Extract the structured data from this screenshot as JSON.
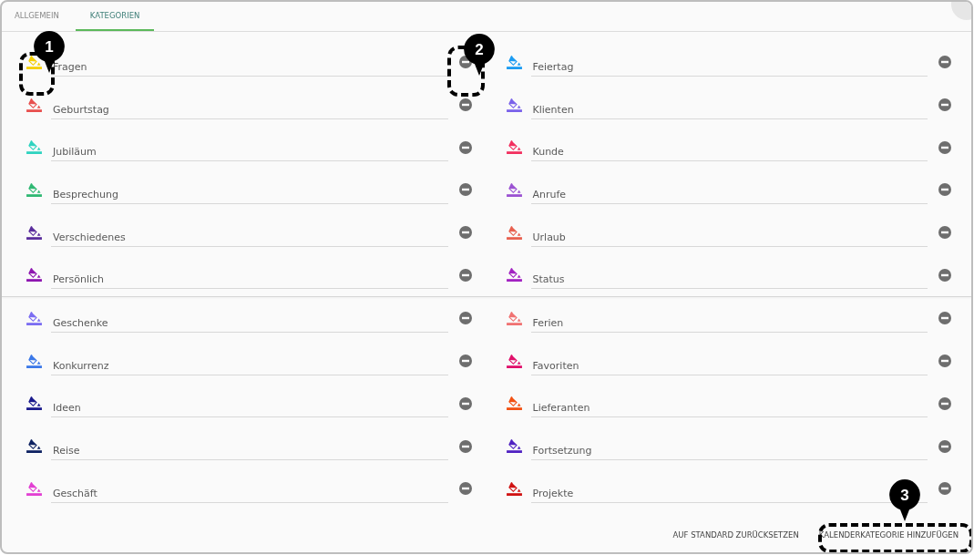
{
  "tabs": [
    {
      "label": "ALLGEMEIN",
      "selected": false
    },
    {
      "label": "KATEGORIEN",
      "selected": true
    }
  ],
  "columns": [
    {
      "items": [
        {
          "name": "Fragen",
          "color": "#f5cf00"
        },
        {
          "name": "Geburtstag",
          "color": "#e8504f"
        },
        {
          "name": "Jubiläum",
          "color": "#2fd3c0"
        },
        {
          "name": "Besprechung",
          "color": "#2fb873"
        },
        {
          "name": "Verschiedenes",
          "color": "#5a2d9c"
        },
        {
          "name": "Persönlich",
          "color": "#8e16b0"
        },
        {
          "name": "Geschenke",
          "color": "#7b6df2"
        },
        {
          "name": "Konkurrenz",
          "color": "#3b78e8"
        },
        {
          "name": "Ideen",
          "color": "#1a1a8c"
        },
        {
          "name": "Reise",
          "color": "#0e2262"
        },
        {
          "name": "Geschäft",
          "color": "#e23fd2"
        }
      ]
    },
    {
      "items": [
        {
          "name": "Feiertag",
          "color": "#1a9bf2"
        },
        {
          "name": "Klienten",
          "color": "#7a62ea"
        },
        {
          "name": "Kunde",
          "color": "#f2305f"
        },
        {
          "name": "Anrufe",
          "color": "#9b52d2"
        },
        {
          "name": "Urlaub",
          "color": "#e8604f"
        },
        {
          "name": "Status",
          "color": "#a222c2"
        },
        {
          "name": "Ferien",
          "color": "#f07272"
        },
        {
          "name": "Favoriten",
          "color": "#e0106b"
        },
        {
          "name": "Lieferanten",
          "color": "#f25012"
        },
        {
          "name": "Fortsetzung",
          "color": "#5022c2"
        },
        {
          "name": "Projekte",
          "color": "#d01212"
        }
      ]
    }
  ],
  "buttons": [
    "AUF STANDARD ZURÜCKSETZEN",
    "KALENDERKATEGORIE HINZUFÜGEN"
  ],
  "callouts": [
    "1",
    "2",
    "3"
  ]
}
